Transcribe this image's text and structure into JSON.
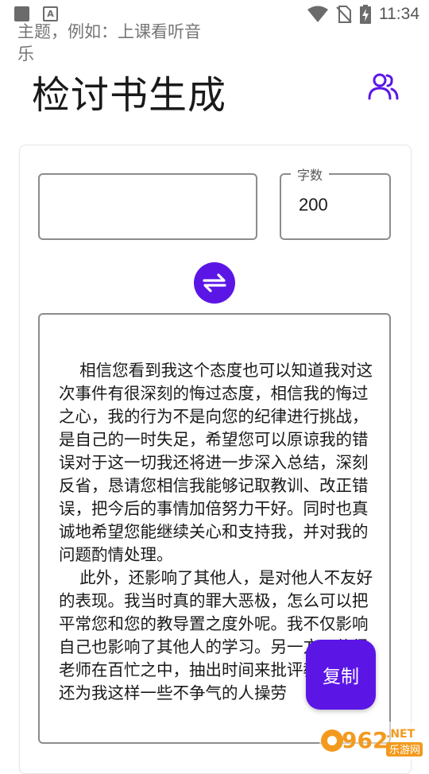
{
  "status_bar": {
    "time": "11:34",
    "left_icons": [
      "notification-square-icon",
      "a-text-icon"
    ],
    "right_icons": [
      "wifi-icon",
      "no-sim-icon",
      "battery-charging-icon"
    ]
  },
  "header": {
    "title": "检讨书生成",
    "users_icon": "users-icon"
  },
  "form": {
    "topic_placeholder": "主题，例如：上课看听音乐",
    "topic_value": "",
    "count_label": "字数",
    "count_value": "200",
    "swap_icon": "swap-arrows-icon"
  },
  "result": {
    "text": "    相信您看到我这个态度也可以知道我对这次事件有很深刻的悔过态度，相信我的悔过之心，我的行为不是向您的纪律进行挑战，是自己的一时失足，希望您可以原谅我的错误对于这一切我还将进一步深入总结，深刻反省，恳请您相信我能够记取教训、改正错误，把今后的事情加倍努力干好。同时也真诚地希望您能继续关心和支持我，并对我的问题酌情处理。\n    此外，还影响了其他人，是对他人不友好的表现。我当时真的罪大恶极，怎么可以把平常您和您的教导置之度外呢。我不仅影响自己也影响了其他人的学习。另一方面使得老师在百忙之中，抽出时间来批评教育我，还为我这样一些不争气的人操劳"
  },
  "copy_button": {
    "label": "复制"
  },
  "watermark": {
    "number": "962",
    "suffix": ".NET",
    "sub": "乐游网"
  },
  "colors": {
    "accent": "#5b16e6",
    "border": "#8c8c8c",
    "watermark_orange": "#f39a1e"
  }
}
